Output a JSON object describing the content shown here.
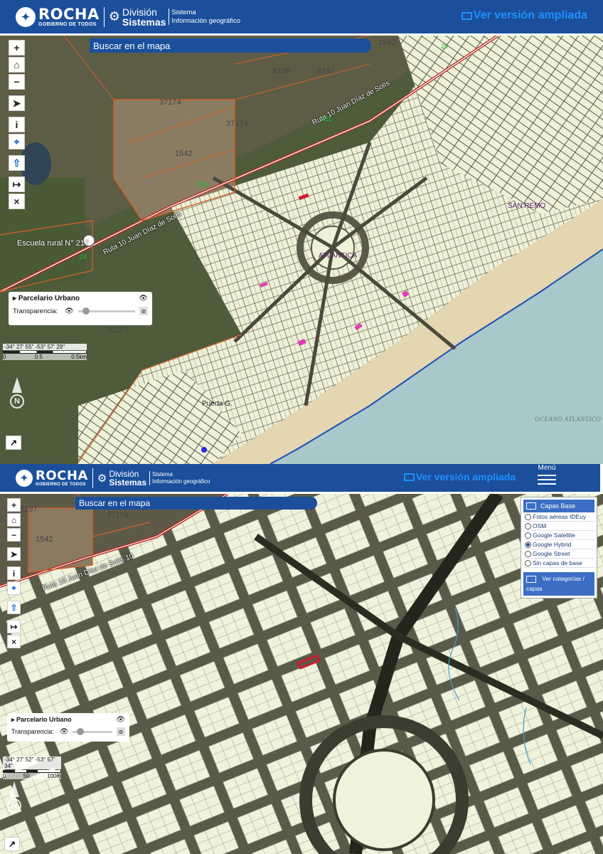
{
  "header": {
    "logo_main": "ROCHA",
    "logo_sub": "GOBIERNO DE TODOS",
    "division_line1": "División",
    "division_line2": "Sistemas",
    "system_line1": "Sistema",
    "system_line2": "Información geográfico",
    "expanded_link": "Ver versión ampliada",
    "menu_label": "Menú"
  },
  "search": {
    "label": "Buscar en el mapa"
  },
  "layer": {
    "title": "Parcelario Urbano",
    "transparency_label": "Transparencia:"
  },
  "panel1": {
    "coords": "-34° 27' 55\" -53° 57' 29\"",
    "scale_labels": [
      "0",
      "0.5",
      "0.5km"
    ],
    "labels": {
      "parcel_6196": "6196",
      "parcel_6197": "6197",
      "parcel_1543": "1543",
      "parcel_37174a": "37174",
      "parcel_37174b": "37174",
      "parcel_1542": "1542",
      "parcel_22371": "22371",
      "road_a": "Ruta 10 Juan Díaz de Solís",
      "road_b": "Ruta 10 Juan Díaz de Solís",
      "route_251": "251",
      "route_250": "250",
      "route_25": "25",
      "route_24": "24",
      "school": "Escuela rural N° 217",
      "san_remo": "SAN REMO",
      "atlantica": "ATLANTICA",
      "puerta": "Puerta G.",
      "ocean": "OCEANO ATLANTICO"
    }
  },
  "panel2": {
    "coords": "-34° 27' 52\" -53° 57' 34\"",
    "scale_labels": [
      "0",
      "50",
      "100m"
    ],
    "labels": {
      "parcel_6197": "6197",
      "parcel_37174": "37174",
      "parcel_1542": "1542",
      "road": "Ruta 10 Juan Díaz de Solís 10"
    },
    "base_layers": {
      "title": "Capas Base",
      "options": [
        {
          "label": "Fotos aéreas IDEuy",
          "selected": false
        },
        {
          "label": "OSM",
          "selected": false
        },
        {
          "label": "Google Satellite",
          "selected": false
        },
        {
          "label": "Google Hybrid",
          "selected": true
        },
        {
          "label": "Google Street",
          "selected": false
        },
        {
          "label": "Sin capas de base",
          "selected": false
        }
      ],
      "categories_line1": "Ver categorías /",
      "categories_line2": "capas"
    }
  },
  "icons": {
    "zoom_in": "plus-icon",
    "home": "home-icon",
    "zoom_out": "minus-icon",
    "locate": "navigation-arrow-icon",
    "info": "info-icon",
    "marker": "map-pin-icon",
    "upload": "upload-icon",
    "measure": "arrow-right-bar-icon",
    "clear": "close-icon",
    "expand": "expand-arrow-icon",
    "visibility": "eye-icon",
    "hide": "eye-off-icon"
  },
  "colors": {
    "header_bg": "#1b4f9c",
    "link": "#1e90ff",
    "parcel_fill": "#f0f3dc",
    "parcel_line": "#c0562a",
    "sea": "#a9c8cc",
    "sand": "#e8dcb8",
    "terrain": "#5d5a44"
  }
}
